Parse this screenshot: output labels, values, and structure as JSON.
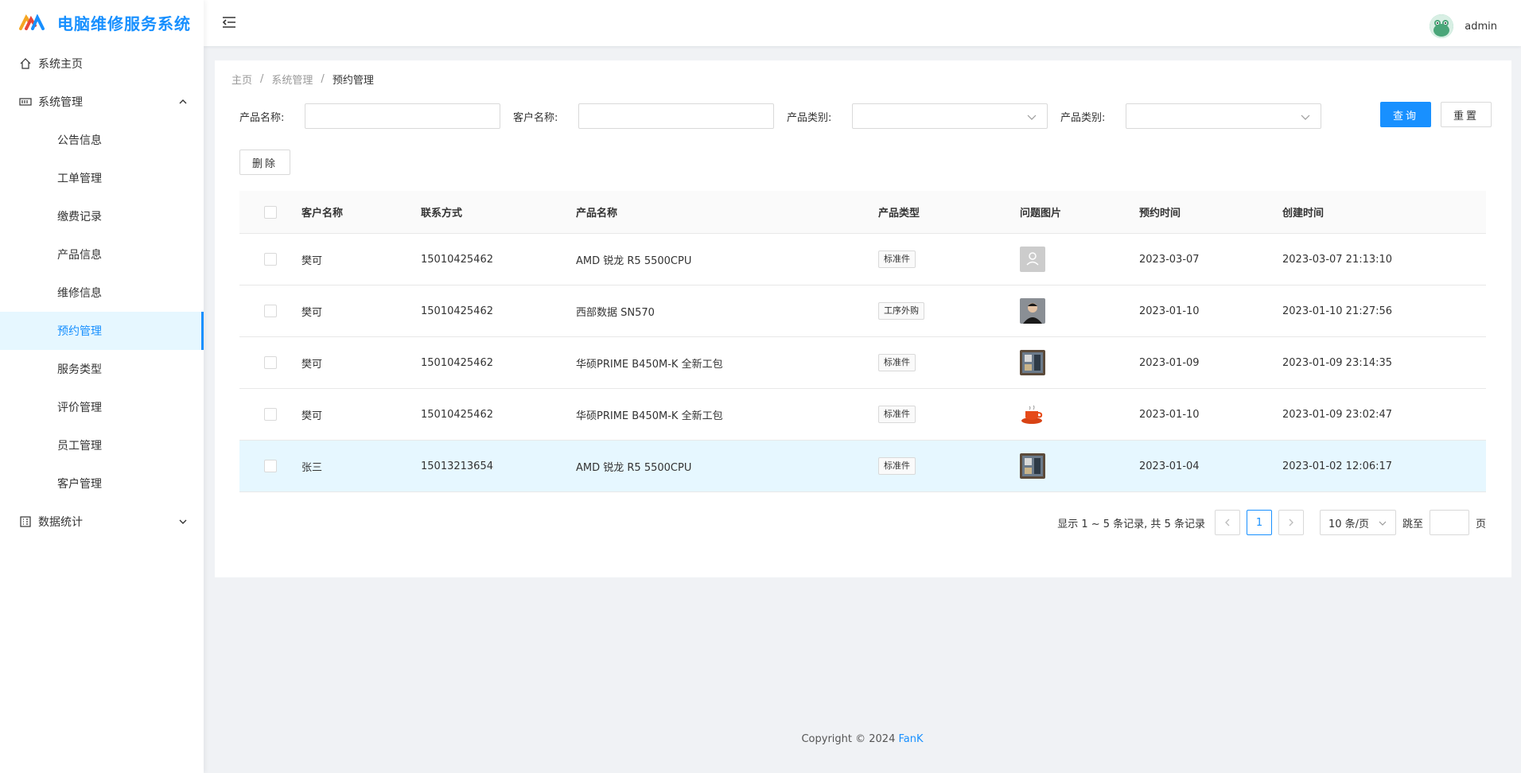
{
  "app": {
    "title": "电脑维修服务系统"
  },
  "sidebar": {
    "home": "系统主页",
    "system": "系统管理",
    "system_items": [
      "公告信息",
      "工单管理",
      "缴费记录",
      "产品信息",
      "维修信息",
      "预约管理",
      "服务类型",
      "评价管理",
      "员工管理",
      "客户管理"
    ],
    "stats": "数据统计"
  },
  "header": {
    "username": "admin"
  },
  "breadcrumb": {
    "home": "主页",
    "parent": "系统管理",
    "current": "预约管理",
    "sep": "/"
  },
  "filters": {
    "product_name_label": "产品名称:",
    "customer_name_label": "客户名称:",
    "product_type_label_1": "产品类别:",
    "product_type_label_2": "产品类别:",
    "search_button": "查询",
    "reset_button": "重置",
    "delete_button": "删除"
  },
  "table": {
    "headers": {
      "customer": "客户名称",
      "phone": "联系方式",
      "product": "产品名称",
      "type": "产品类型",
      "image": "问题图片",
      "booking": "预约时间",
      "created": "创建时间"
    },
    "rows": [
      {
        "customer": "樊可",
        "phone": "15010425462",
        "product": "AMD 锐龙 R5 5500CPU",
        "type": "标准件",
        "booking": "2023-03-07",
        "created": "2023-03-07 21:13:10",
        "image": "placeholder-user-icon"
      },
      {
        "customer": "樊可",
        "phone": "15010425462",
        "product": "西部数据 SN570",
        "type": "工序外购",
        "booking": "2023-01-10",
        "created": "2023-01-10 21:27:56",
        "image": "person-photo"
      },
      {
        "customer": "樊可",
        "phone": "15010425462",
        "product": "华硕PRIME B450M-K 全新工包",
        "type": "标准件",
        "booking": "2023-01-09",
        "created": "2023-01-09 23:14:35",
        "image": "board-photo"
      },
      {
        "customer": "樊可",
        "phone": "15010425462",
        "product": "华硕PRIME B450M-K 全新工包",
        "type": "标准件",
        "booking": "2023-01-10",
        "created": "2023-01-09 23:02:47",
        "image": "coffee-cup-photo"
      },
      {
        "customer": "张三",
        "phone": "15013213654",
        "product": "AMD 锐龙 R5 5500CPU",
        "type": "标准件",
        "booking": "2023-01-04",
        "created": "2023-01-02 12:06:17",
        "image": "board-photo"
      }
    ]
  },
  "pagination": {
    "summary": "显示 1 ~ 5 条记录, 共 5 条记录",
    "current_page": "1",
    "page_size": "10 条/页",
    "jump_label": "跳至",
    "page_suffix": "页"
  },
  "footer": {
    "copyright": "Copyright © 2024",
    "brand": "FanK"
  },
  "colors": {
    "primary": "#1890ff",
    "active_bg": "#e6f7ff",
    "border": "#d9d9d9"
  }
}
